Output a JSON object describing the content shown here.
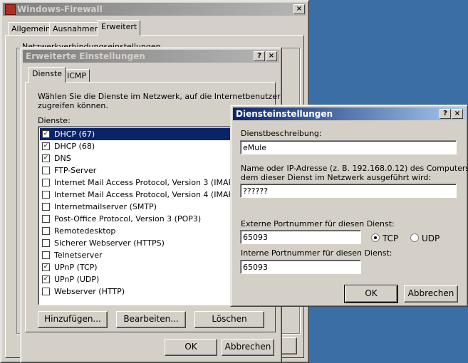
{
  "firewall": {
    "title": "Windows-Firewall",
    "tabs": [
      "Allgemein",
      "Ausnahmen",
      "Erweitert"
    ],
    "group_label": "Netzwerkverbindungseinstellungen",
    "close_btn_partial": "hen"
  },
  "advanced": {
    "title": "Erweiterte Einstellungen",
    "tabs": [
      "Dienste",
      "ICMP"
    ],
    "description": "Wählen Sie die Dienste im Netzwerk, auf die Internetbenutzer zugreifen können.",
    "description_line1": "Wählen Sie die Dienste im Netzwerk, auf die Internetbenutzer",
    "description_line2": "zugreifen können.",
    "services_label": "Dienste:",
    "services": [
      {
        "label": "DHCP (67)",
        "checked": true,
        "selected": true
      },
      {
        "label": "DHCP (68)",
        "checked": true
      },
      {
        "label": "DNS",
        "checked": true
      },
      {
        "label": "FTP-Server",
        "checked": false
      },
      {
        "label": "Internet Mail Access Protocol, Version 3 (IMAP3)",
        "checked": false
      },
      {
        "label": "Internet Mail Access Protocol, Version 4 (IMAP4)",
        "checked": false
      },
      {
        "label": "Internetmailserver (SMTP)",
        "checked": false
      },
      {
        "label": "Post-Office Protocol, Version 3 (POP3)",
        "checked": false
      },
      {
        "label": "Remotedesktop",
        "checked": false
      },
      {
        "label": "Sicherer Webserver (HTTPS)",
        "checked": false
      },
      {
        "label": "Telnetserver",
        "checked": false
      },
      {
        "label": "UPnP (TCP)",
        "checked": true
      },
      {
        "label": "UPnP (UDP)",
        "checked": true
      },
      {
        "label": "Webserver (HTTP)",
        "checked": false
      }
    ],
    "add_label": "Hinzufügen...",
    "edit_label": "Bearbeiten...",
    "delete_label": "Löschen",
    "ok_label": "OK",
    "cancel_label": "Abbrechen"
  },
  "service_dialog": {
    "title": "Diensteinstellungen",
    "desc_label": "Dienstbeschreibung:",
    "desc_value": "eMule",
    "host_label_line1": "Name oder IP-Adresse (z. B. 192.168.0.12) des Computers, auf",
    "host_label_line2": "dem dieser Dienst im Netzwerk ausgeführt wird:",
    "host_value": "??????",
    "ext_port_label": "Externe Portnummer für diesen Dienst:",
    "ext_port_value": "65093",
    "int_port_label": "Interne Portnummer für diesen Dienst:",
    "int_port_value": "65093",
    "tcp_label": "TCP",
    "udp_label": "UDP",
    "ok_label": "OK",
    "cancel_label": "Abbrechen"
  },
  "title_buttons": {
    "help": "?",
    "close": "×"
  }
}
